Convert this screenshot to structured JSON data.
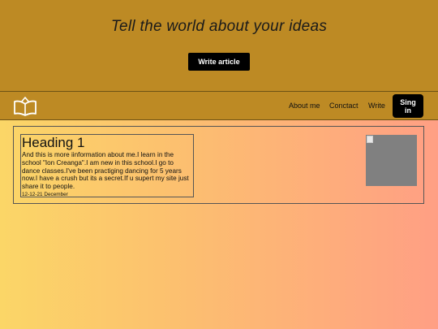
{
  "hero": {
    "tagline": "Tell the world about your ideas",
    "write_article_label": "Write article",
    "background_color": "#bd8a24"
  },
  "navbar": {
    "logo_icon": "open-book-icon",
    "links": [
      {
        "label": "About me"
      },
      {
        "label": "Conctact"
      },
      {
        "label": "Write"
      }
    ],
    "signin_label": "Sing in"
  },
  "article": {
    "heading": "Heading 1",
    "body": "And this is more iinformation about me.I learn in the school \"Ion Creanga\".I am new in this school.I go to dance classes.I've been practiging dancing for 5 years now.I have a crush but its a secret.If u supert my site just share it to people.",
    "date": "12-12-21 December",
    "image_icon": "broken-image-icon"
  }
}
